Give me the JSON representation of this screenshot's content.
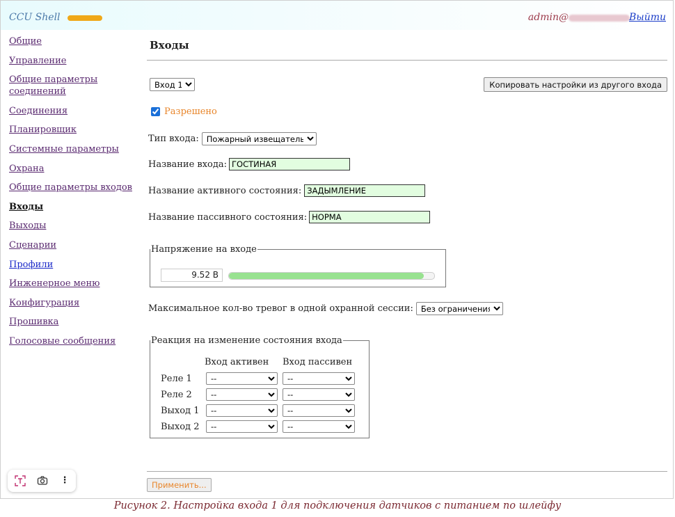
{
  "header": {
    "app_title": "CCU Shell",
    "user": "admin@",
    "logout": "Выйти"
  },
  "sidebar": {
    "items": [
      {
        "label": "Общие"
      },
      {
        "label": "Управление"
      },
      {
        "label": "Общие параметры соединений"
      },
      {
        "label": "Соединения"
      },
      {
        "label": "Планировщик"
      },
      {
        "label": "Системные параметры"
      },
      {
        "label": "Охрана"
      },
      {
        "label": "Общие параметры входов"
      },
      {
        "label": "Входы",
        "active": true
      },
      {
        "label": "Выходы"
      },
      {
        "label": "Сценарии"
      },
      {
        "label": "Профили"
      },
      {
        "label": "Инженерное меню"
      },
      {
        "label": "Конфигурация"
      },
      {
        "label": "Прошивка"
      },
      {
        "label": "Голосовые сообщения"
      }
    ]
  },
  "main": {
    "title": "Входы",
    "input_select": "Вход 1",
    "copy_button": "Копировать настройки из другого входа",
    "enabled_label": "Разрешено",
    "enabled_checked": true,
    "type_label": "Тип входа:",
    "type_value": "Пожарный извещатель",
    "name_label": "Название входа:",
    "name_value": "ГОСТИНАЯ",
    "active_label": "Название активного состояния:",
    "active_value": "ЗАДЫМЛЕНИЕ",
    "passive_label": "Название пассивного состояния:",
    "passive_value": "НОРМА",
    "voltage_legend": "Напряжение на входе",
    "voltage_value": "9.52 В",
    "voltage_level": 0.95,
    "max_alarms_label": "Максимальное кол-во тревог в одной охранной сессии:",
    "max_alarms_value": "Без ограничения",
    "reaction_legend": "Реакция на изменение состояния входа",
    "col_active": "Вход активен",
    "col_passive": "Вход пассивен",
    "reaction_rows": [
      {
        "label": "Реле 1",
        "active": "--",
        "passive": "--"
      },
      {
        "label": "Реле 2",
        "active": "--",
        "passive": "--"
      },
      {
        "label": "Выход 1",
        "active": "--",
        "passive": "--"
      },
      {
        "label": "Выход 2",
        "active": "--",
        "passive": "--"
      }
    ],
    "apply_button": "Применить..."
  },
  "caption": "Рисунок 2. Настройка входа 1 для подключения датчиков с питанием по шлейфу",
  "colors": {
    "accent_orange": "#f0a818",
    "field_green": "#e2fde0",
    "bar_green": "#98e290"
  }
}
